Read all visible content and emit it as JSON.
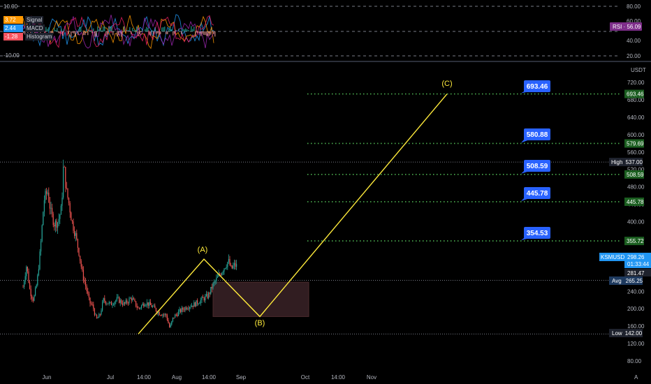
{
  "indicator_legend": [
    {
      "value": "3.72",
      "name": "Signal",
      "color": "#ff9800"
    },
    {
      "value": "2.44",
      "name": "MACD",
      "color": "#2196f3"
    },
    {
      "value": "-1.28",
      "name": "Histogram",
      "color": "#f7525f"
    }
  ],
  "rsi_badge": "RSI · 56.09",
  "currency_label": "USDT",
  "price_badge": {
    "symbol": "KSMUSDT",
    "price": "298.26",
    "countdown": "01:33:44"
  },
  "high_badge": {
    "label": "High",
    "value": "537.00"
  },
  "low_badge": {
    "label": "Low",
    "value": "142.00"
  },
  "avg_badge": {
    "label": "Avg",
    "value": "265.25"
  },
  "level_281": "281.47",
  "bottom_right_label": "A",
  "colors": {
    "background": "#000000",
    "up": "#26a69a",
    "down": "#ef5350",
    "wave": "#ffeb3b",
    "target_dots": "#4caf50",
    "callout": "#2962ff",
    "box": "#3a2327"
  },
  "chart_data": {
    "type": "line",
    "ylabel": "USDT",
    "ylim": [
      62,
      743
    ],
    "y_ticks": [
      720,
      680,
      640,
      600,
      560,
      520,
      480,
      440,
      400,
      360,
      320,
      280,
      240,
      200,
      160,
      120,
      80
    ],
    "x_tick_labels": [
      "Jun",
      "Jul",
      "14:00",
      "Aug",
      "14:00",
      "Sep",
      "Oct",
      "14:00",
      "Nov"
    ],
    "indicator_y_ticks": [
      "80.00",
      "60.00",
      "40.00",
      "20.00",
      "10.00",
      "-10.00"
    ],
    "price_series": [
      {
        "x": 0,
        "y": 250
      },
      {
        "x": 5,
        "y": 300
      },
      {
        "x": 10,
        "y": 240
      },
      {
        "x": 15,
        "y": 220
      },
      {
        "x": 20,
        "y": 260
      },
      {
        "x": 25,
        "y": 340
      },
      {
        "x": 30,
        "y": 450
      },
      {
        "x": 35,
        "y": 470
      },
      {
        "x": 40,
        "y": 420
      },
      {
        "x": 45,
        "y": 395
      },
      {
        "x": 50,
        "y": 400
      },
      {
        "x": 55,
        "y": 430
      },
      {
        "x": 58,
        "y": 535
      },
      {
        "x": 62,
        "y": 470
      },
      {
        "x": 66,
        "y": 440
      },
      {
        "x": 70,
        "y": 400
      },
      {
        "x": 75,
        "y": 370
      },
      {
        "x": 80,
        "y": 330
      },
      {
        "x": 85,
        "y": 280
      },
      {
        "x": 90,
        "y": 250
      },
      {
        "x": 95,
        "y": 215
      },
      {
        "x": 100,
        "y": 205
      },
      {
        "x": 105,
        "y": 175
      },
      {
        "x": 110,
        "y": 185
      },
      {
        "x": 115,
        "y": 220
      },
      {
        "x": 125,
        "y": 210
      },
      {
        "x": 135,
        "y": 222
      },
      {
        "x": 145,
        "y": 210
      },
      {
        "x": 155,
        "y": 225
      },
      {
        "x": 165,
        "y": 200
      },
      {
        "x": 175,
        "y": 215
      },
      {
        "x": 185,
        "y": 205
      },
      {
        "x": 195,
        "y": 190
      },
      {
        "x": 205,
        "y": 185
      },
      {
        "x": 210,
        "y": 155
      },
      {
        "x": 215,
        "y": 180
      },
      {
        "x": 225,
        "y": 195
      },
      {
        "x": 235,
        "y": 205
      },
      {
        "x": 245,
        "y": 210
      },
      {
        "x": 255,
        "y": 220
      },
      {
        "x": 265,
        "y": 230
      },
      {
        "x": 272,
        "y": 255
      },
      {
        "x": 280,
        "y": 275
      },
      {
        "x": 288,
        "y": 295
      },
      {
        "x": 294,
        "y": 310
      },
      {
        "x": 298,
        "y": 290
      },
      {
        "x": 302,
        "y": 300
      },
      {
        "x": 306,
        "y": 298
      }
    ],
    "wave_path": [
      {
        "x": 198,
        "y": 142
      },
      {
        "x": 292,
        "y": 314
      },
      {
        "x": 372,
        "y": 182
      },
      {
        "x": 640,
        "y": 693.46
      }
    ],
    "wave_labels": [
      {
        "text": "(A)",
        "x": 290,
        "y": 330
      },
      {
        "text": "(B)",
        "x": 372,
        "y": 162
      },
      {
        "text": "(C)",
        "x": 640,
        "y": 712
      }
    ],
    "targets": [
      {
        "callout": "693.46",
        "axis_label": "693.46",
        "value": 693.46
      },
      {
        "callout": "580.88",
        "axis_label": "579.69",
        "value": 579.69
      },
      {
        "callout": "508.59",
        "axis_label": "508.59",
        "value": 508.59
      },
      {
        "callout": "445.78",
        "axis_label": "445.78",
        "value": 445.78
      },
      {
        "callout": "354.53",
        "axis_label": "355.72",
        "value": 355.72
      }
    ],
    "box_range": {
      "y_top": 261,
      "y_bottom": 182
    },
    "dotted_levels": {
      "high": 537,
      "low": 142
    }
  }
}
